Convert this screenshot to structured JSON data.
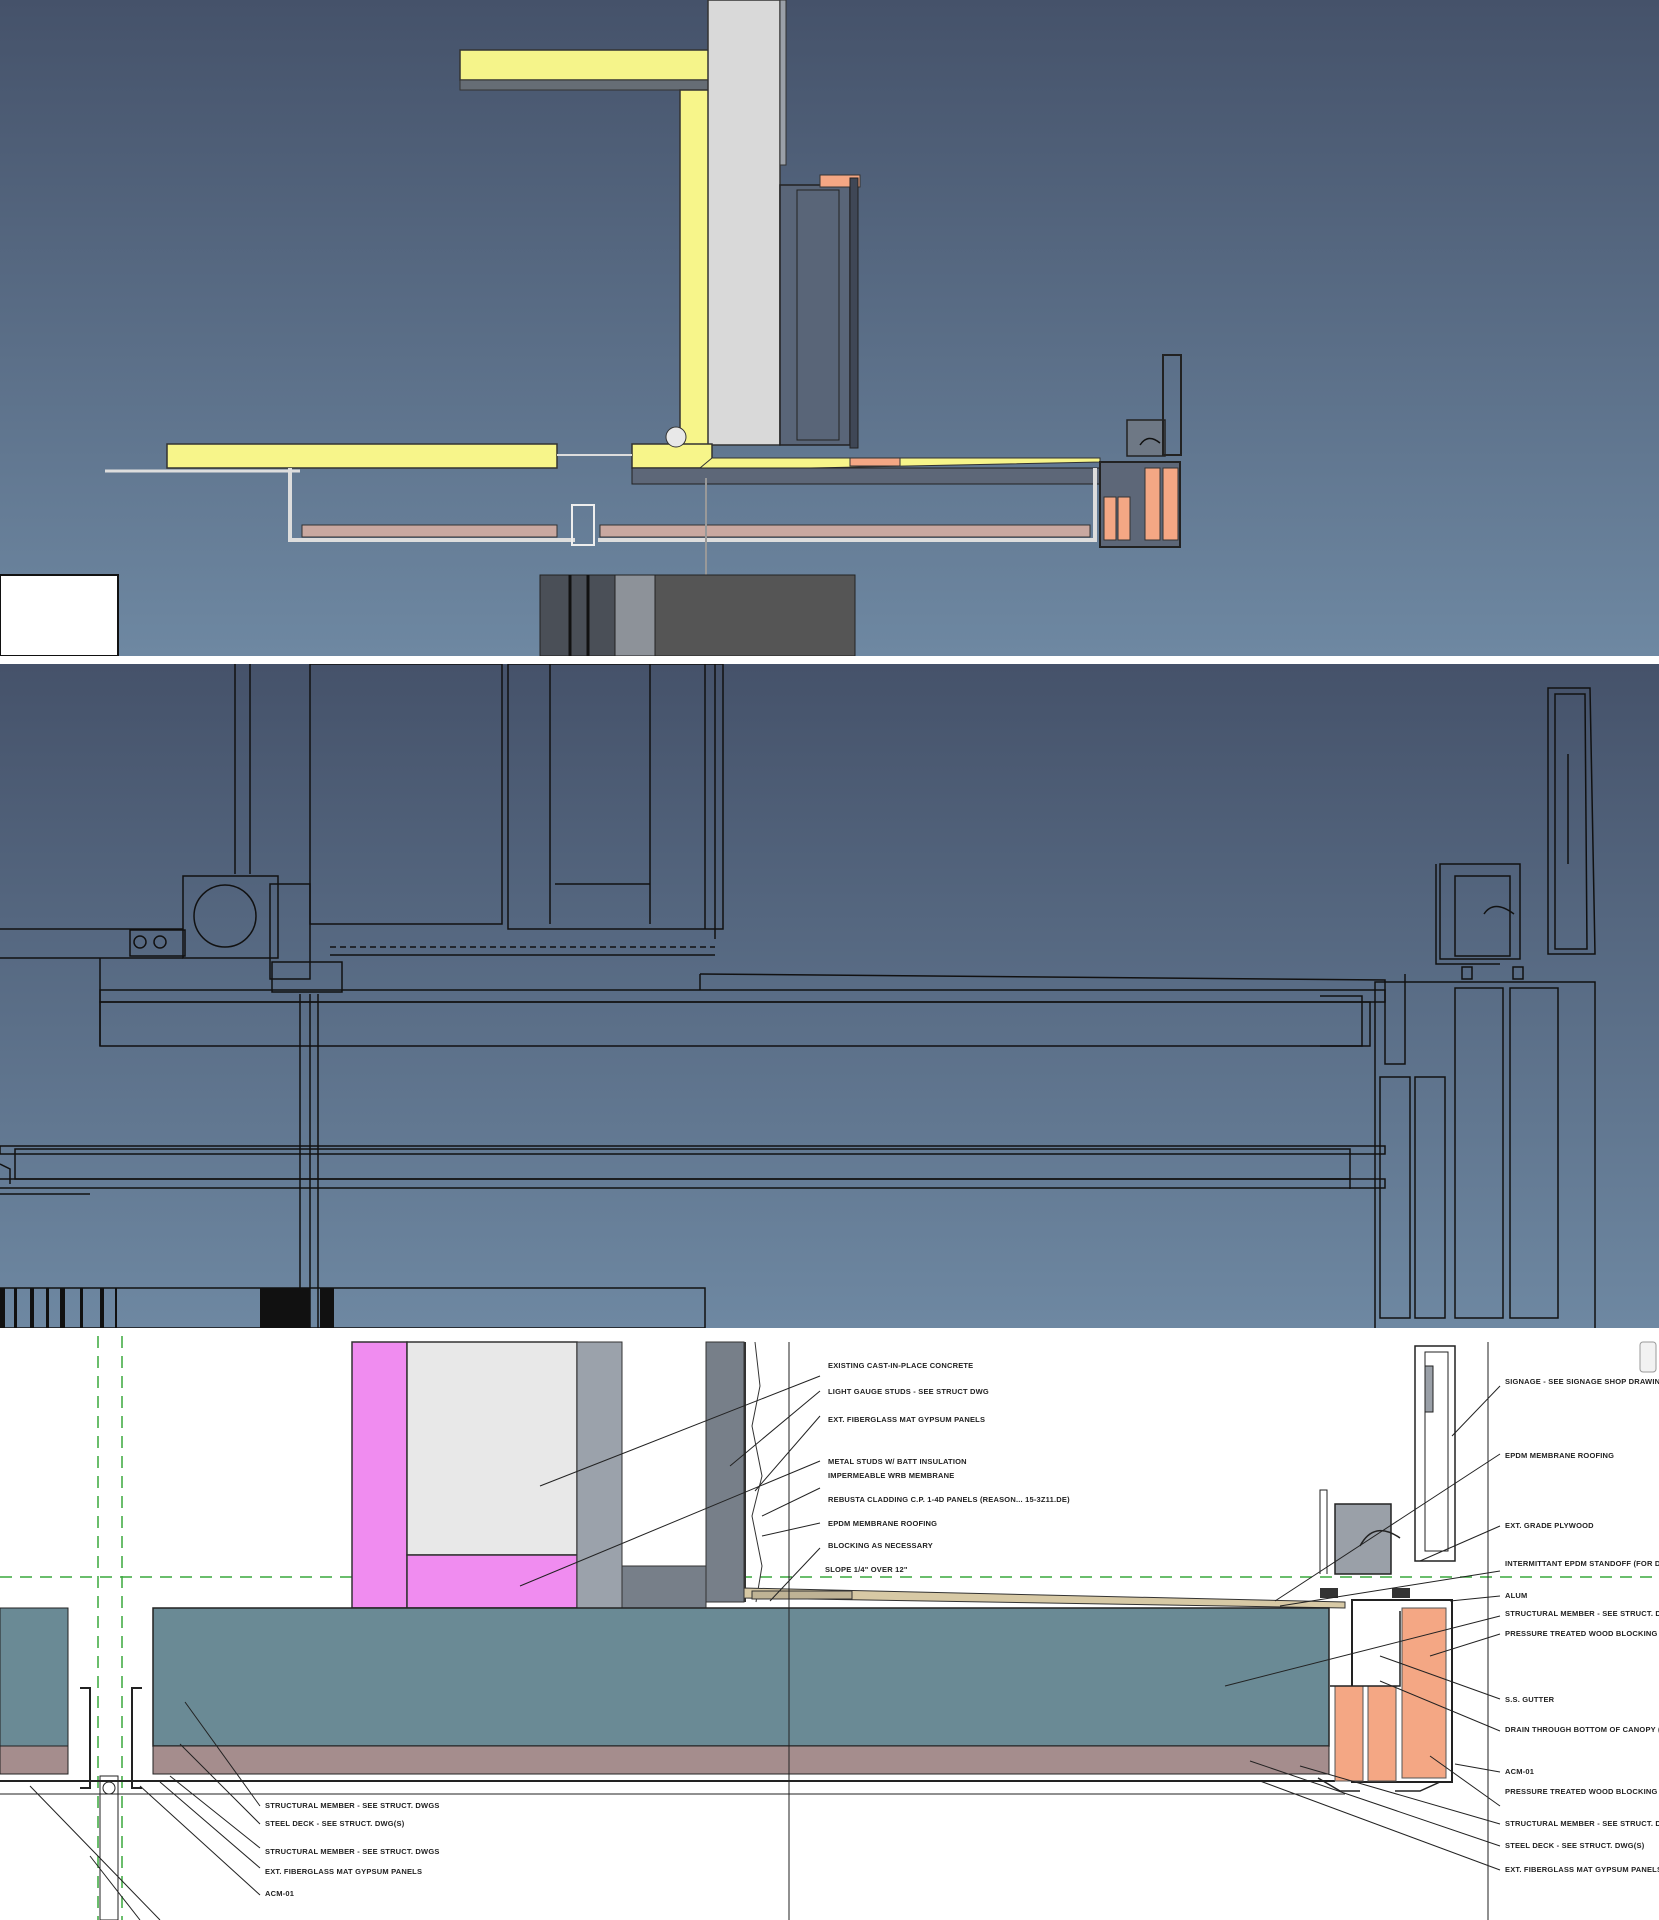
{
  "colors": {
    "bg_top": "#46536b",
    "bg_bottom": "#6d86a0",
    "insulation_yellow": "#f5f48a",
    "membrane_pink": "#f08cf0",
    "concrete_gray": "#e8e8e8",
    "blocking_orange": "#f4a784",
    "structural_teal": "#6a8a95",
    "deck_mauve": "#a58d8d",
    "gridline_green": "#39a83c"
  },
  "detail_notes": {
    "existing_concrete": "EXISTING CAST-IN-PLACE CONCRETE",
    "light_gauge_studs": "LIGHT GAUGE STUDS - SEE STRUCT DWG",
    "ext_fiberglass_gypsum_1": "EXT. FIBERGLASS MAT GYPSUM PANELS",
    "metal_studs_insulation": "METAL STUDS W/ BATT INSULATION",
    "impermeable_membrane": "IMPERMEABLE WRB MEMBRANE",
    "rainscreen_cladding": "REBUSTA CLADDING C.P. 1-4D PANELS (REASON... 15-3Z11.DE)",
    "epdm_roofing_1": "EPDM MEMBRANE ROOFING",
    "blocking_as_necessary": "BLOCKING AS NECESSARY",
    "slope": "SLOPE 1/4\" OVER 12\"",
    "signage": "SIGNAGE - SEE SIGNAGE SHOP DRAWINGS",
    "epdm_roofing_2": "EPDM MEMBRANE ROOFING",
    "ext_grade_plywood": "EXT. GRADE PLYWOOD",
    "intermittent_epdm": "INTERMITTANT EPDM STANDOFF (FOR DRAINAGE)",
    "alum": "ALUM",
    "structural_member_r1": "STRUCTURAL MEMBER - SEE STRUCT. DWGS",
    "pt_wood_blocking_r1": "PRESSURE TREATED WOOD BLOCKING - SEE AS NECESSARY",
    "ss_gutter": "S.S. GUTTER",
    "drain_through": "DRAIN THROUGH BOTTOM OF CANOPY (BEYOND)",
    "acm_01_r": "ACM-01",
    "pt_wood_blocking_r2": "PRESSURE TREATED WOOD BLOCKING - SEE AS NECESSARY",
    "structural_member_r2": "STRUCTURAL MEMBER - SEE STRUCT. DWGS",
    "steel_deck_r": "STEEL DECK - SEE STRUCT. DWG(S)",
    "ext_fiberglass_gypsum_r": "EXT. FIBERGLASS MAT GYPSUM PANELS",
    "structural_member_l1": "STRUCTURAL MEMBER - SEE STRUCT. DWGS",
    "steel_deck_l": "STEEL DECK - SEE STRUCT. DWG(S)",
    "structural_member_l2": "STRUCTURAL MEMBER - SEE STRUCT. DWGS",
    "ext_fiberglass_gypsum_l": "EXT. FIBERGLASS MAT GYPSUM PANELS",
    "acm_01_l": "ACM-01"
  }
}
